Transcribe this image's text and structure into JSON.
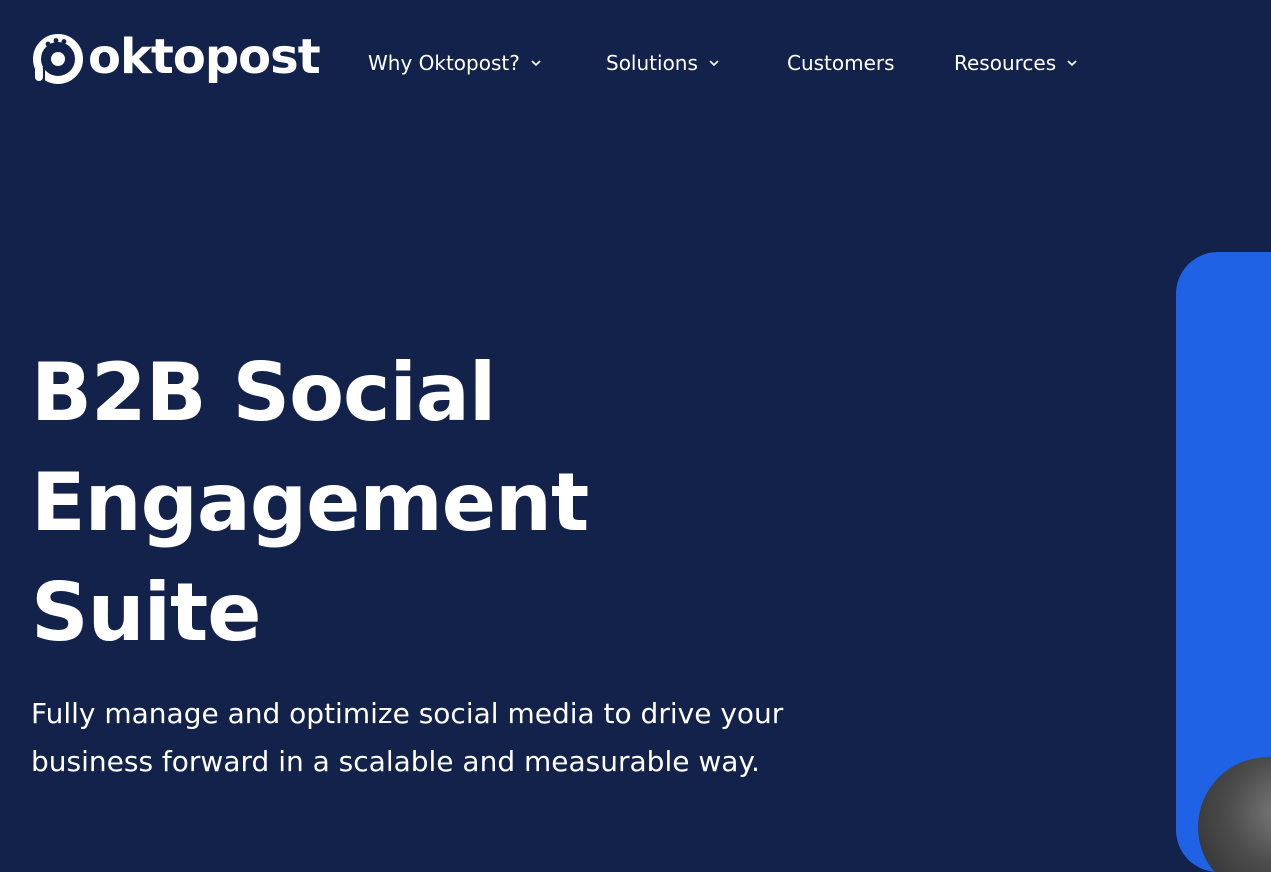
{
  "brand": {
    "name": "oktopost",
    "logo_icon": "octopus-swirl-icon"
  },
  "nav": {
    "items": [
      {
        "label": "Why Oktopost?",
        "has_dropdown": true
      },
      {
        "label": "Solutions",
        "has_dropdown": true
      },
      {
        "label": "Customers",
        "has_dropdown": false
      },
      {
        "label": "Resources",
        "has_dropdown": true
      }
    ]
  },
  "hero": {
    "title_lines": [
      "B2B Social",
      "Engagement",
      "Suite"
    ],
    "subtitle_lines": [
      "Fully manage and optimize social media to drive your",
      "business forward in a scalable and measurable way."
    ]
  },
  "colors": {
    "background": "#12224a",
    "accent": "#2062e6",
    "text": "#ffffff"
  }
}
